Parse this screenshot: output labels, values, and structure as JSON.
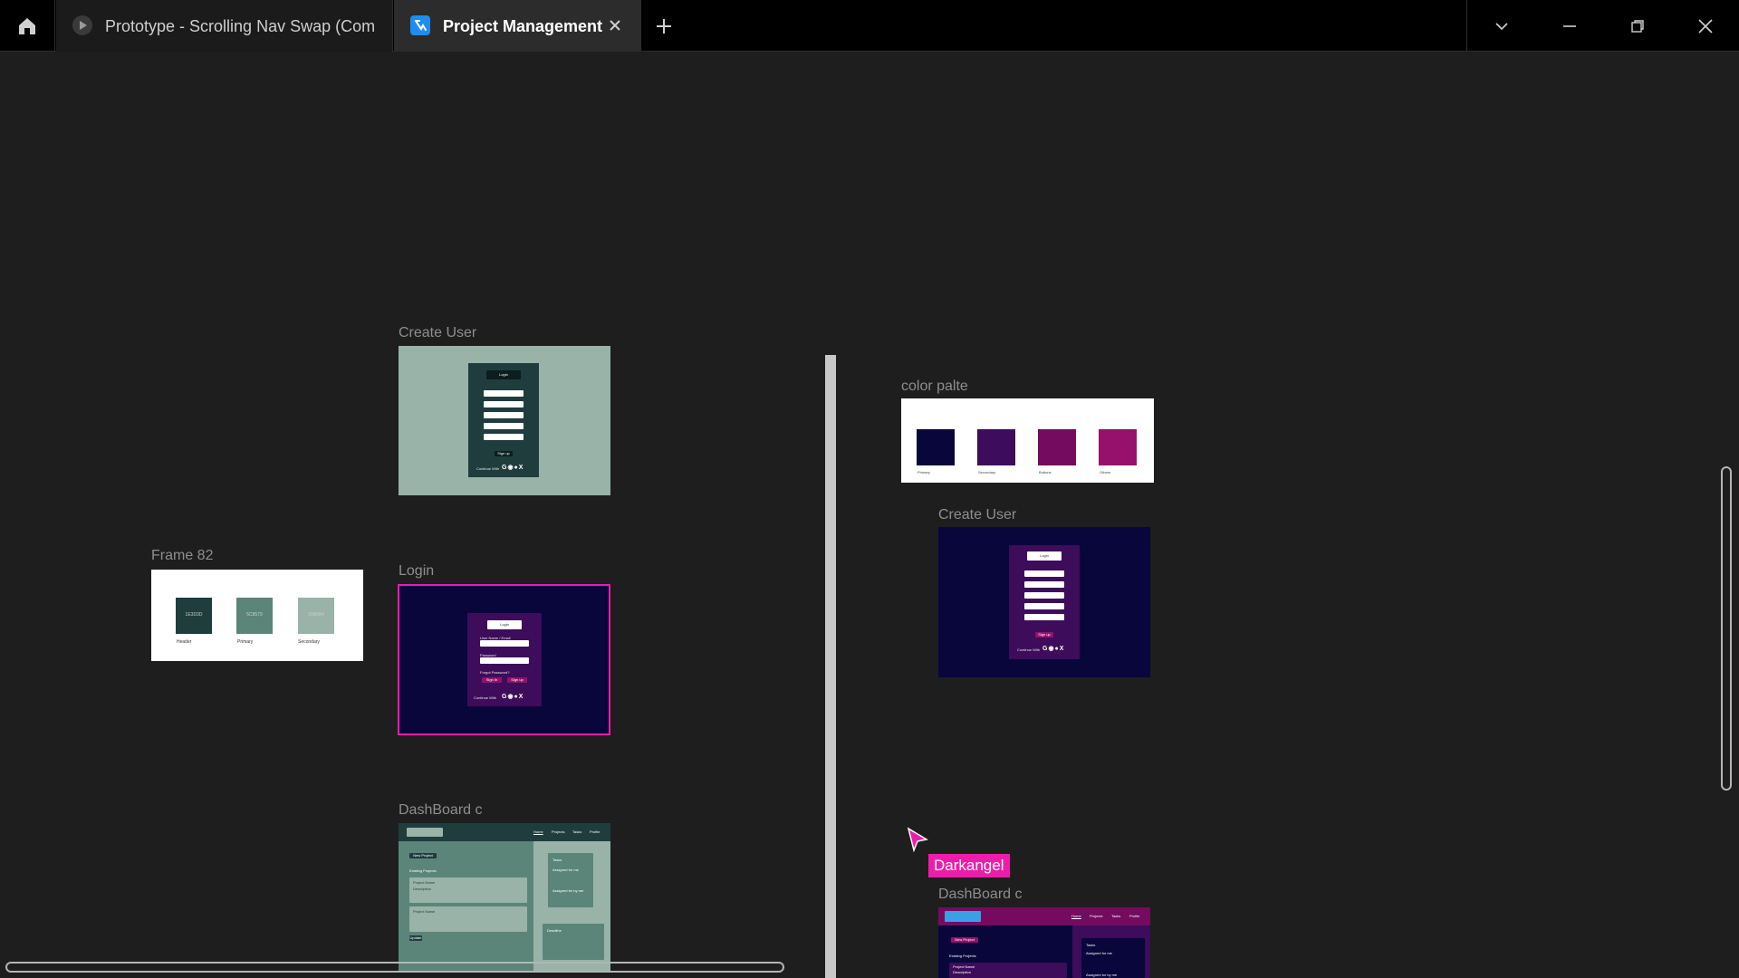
{
  "tabs": {
    "prototype": {
      "label": "Prototype - Scrolling Nav Swap (Com"
    },
    "project": {
      "label": "Project Management"
    }
  },
  "canvas": {
    "frame82": {
      "label": "Frame 82",
      "swatches": [
        {
          "hex": "1E3D3D",
          "name": "Header",
          "color": "#1f3d3d"
        },
        {
          "hex": "5C8579",
          "name": "Primary",
          "color": "#5b8579"
        },
        {
          "hex": "99B0A4",
          "name": "Secondary",
          "color": "#99b3a8"
        }
      ]
    },
    "create_user_green": {
      "label": "Create User",
      "title": "Login",
      "signup": "Sign up",
      "continue": "Continue With",
      "icons": "G◉●X"
    },
    "login": {
      "label": "Login",
      "title": "Login",
      "username": "User Name / Email",
      "password": "Password",
      "forgot": "Forgot Password?",
      "btn_login": "Sign In",
      "btn_signup": "Sign up",
      "continue": "Continue With",
      "icons": "G◉●X"
    },
    "dashboard_green": {
      "label": "DashBoard c",
      "nav": [
        "Home",
        "Projects",
        "Tasks",
        "Profile"
      ],
      "new_project": "New Project",
      "existing": "Existing Projects",
      "project_name": "Project Name",
      "description": "Description",
      "tasks": "Tasks",
      "assigned_me": "Assigned for me",
      "assigned_by_me": "Assigned for by me",
      "deadline": "Deadline",
      "update": "Update"
    },
    "color_palte": {
      "label": "color palte",
      "swatches": [
        {
          "name": "Primary",
          "color": "#08063b"
        },
        {
          "name": "Secondary",
          "color": "#3d0c5a"
        },
        {
          "name": "Buttons",
          "color": "#740b5e"
        },
        {
          "name": "Others",
          "color": "#95116c"
        }
      ]
    },
    "create_user_dark": {
      "label": "Create User",
      "title": "Login",
      "signup": "Sign up",
      "continue": "Continue With",
      "icons": "G◉●X"
    },
    "dashboard_dark": {
      "label": "DashBoard c",
      "nav": [
        "Home",
        "Projects",
        "Tasks",
        "Profile"
      ],
      "new_project": "New Project",
      "existing": "Existing Projects",
      "project_name": "Project Name",
      "description": "Description",
      "tasks": "Tasks",
      "assigned_me": "Assigned for me",
      "assigned_by_me": "Assigned for by me"
    },
    "cursor_user": "Darkangel"
  },
  "colors": {
    "selection": "#ee1cab",
    "green_bg": "#99b3a8",
    "green_panel": "#1f3d3d",
    "dark_bg": "#08063b",
    "dark_panel": "#3d0c5a"
  }
}
